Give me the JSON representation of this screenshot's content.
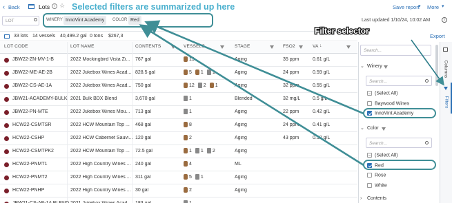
{
  "header": {
    "back_label": "Back",
    "title": "Lots",
    "save_report_label": "Save report",
    "more_label": "More"
  },
  "filter_bar": {
    "lot_placeholder": "LOT",
    "winery_key": "WINERY",
    "winery_value": "InnoVint Academy",
    "color_key": "COLOR",
    "color_value": "Red",
    "last_updated": "Last updated 1/10/24, 10:02 AM"
  },
  "summary": {
    "lots": "33 lots",
    "vessels": "14 vessels",
    "gallons": "40,499.2 gal",
    "tons": "0 tons",
    "value": "$267,3",
    "export_label": "Export"
  },
  "columns": [
    "LOT CODE",
    "LOT NAME",
    "CONTENTS",
    "VESSELS",
    "STAGE",
    "FSO2",
    "VA"
  ],
  "rows": [
    {
      "code": "JBW22-ZN-MV-1-B",
      "name": "2022 Mockingbird Vista Zi...",
      "contents": "767 gal",
      "vessels": [
        [
          "barrel",
          "13"
        ]
      ],
      "stage": "Aging",
      "fso2": "35 ppm",
      "va": "0.61 g/L"
    },
    {
      "code": "JBW22-ME-AE-2B",
      "name": "2022 Jukebox Wines Acad...",
      "contents": "828.5 gal",
      "vessels": [
        [
          "barrel",
          "5"
        ],
        [
          "barrel",
          "1"
        ],
        [
          "tank",
          "1"
        ]
      ],
      "stage": "Aging",
      "fso2": "24 ppm",
      "va": "0.59 g/L"
    },
    {
      "code": "JBW22-CS-AE-1A",
      "name": "2022 Jukebox Wines Acad...",
      "contents": "750 gal",
      "vessels": [
        [
          "barrel",
          "12"
        ],
        [
          "tank",
          "2"
        ],
        [
          "barrel",
          "1"
        ]
      ],
      "stage": "Aging",
      "fso2": "32 ppm",
      "va": "0.55 g/L"
    },
    {
      "code": "JBW21-ACADEMY-BULK",
      "name": "2021 Bulk BDX Blend",
      "contents": "3,670 gal",
      "vessels": [
        [
          "tank",
          "1"
        ]
      ],
      "stage": "Blended",
      "fso2": "32 mg/L",
      "va": "0.5 g/L"
    },
    {
      "code": "JBW22-PN-MTE",
      "name": "2022 Jukebox Wines Mou...",
      "contents": "713 gal",
      "vessels": [
        [
          "tank",
          "1"
        ]
      ],
      "stage": "Aging",
      "fso2": "22 ppm",
      "va": "0.42 g/L"
    },
    {
      "code": "HCW22-CSMTSR",
      "name": "2022 HCW Mountain Top ...",
      "contents": "468 gal",
      "vessels": [
        [
          "barrel",
          "8"
        ]
      ],
      "stage": "Aging",
      "fso2": "24 ppm",
      "va": "0.41 g/L"
    },
    {
      "code": "HCW22-CSHP",
      "name": "2022 HCW Cabernet Sauvi...",
      "contents": "120 gal",
      "vessels": [
        [
          "barrel",
          "2"
        ]
      ],
      "stage": "Aging",
      "fso2": "43 ppm",
      "va": "0.32 g/L"
    },
    {
      "code": "HCW22-CSMTPK2",
      "name": "2022 HCW Mountain Top ...",
      "contents": "72.5 gal",
      "vessels": [
        [
          "barrel",
          "1"
        ],
        [
          "tank",
          "1"
        ],
        [
          "tank",
          "2"
        ]
      ],
      "stage": "Aging",
      "fso2": "",
      "va": ""
    },
    {
      "code": "HCW22-PNMT1",
      "name": "2022 High Country Wines ...",
      "contents": "240 gal",
      "vessels": [
        [
          "barrel",
          "4"
        ]
      ],
      "stage": "ML",
      "fso2": "",
      "va": ""
    },
    {
      "code": "HCW22-PNMT2",
      "name": "2022 High Country Wines ...",
      "contents": "311 gal",
      "vessels": [
        [
          "barrel",
          "5"
        ],
        [
          "tank",
          "1"
        ]
      ],
      "stage": "Aging",
      "fso2": "",
      "va": ""
    },
    {
      "code": "HCW22-PNHP",
      "name": "2022 High Country Wines ...",
      "contents": "30 gal",
      "vessels": [
        [
          "barrel",
          "2"
        ]
      ],
      "stage": "Aging",
      "fso2": "",
      "va": ""
    },
    {
      "code": "JBW21-CS-AE-1A BLEND",
      "name": "2021 Jukebox Wines Acad...",
      "contents": "183 gal",
      "vessels": [
        [
          "tank",
          "1"
        ]
      ],
      "stage": "",
      "fso2": "",
      "va": ""
    }
  ],
  "filter_panel": {
    "search_placeholder": "Search...",
    "winery_title": "Winery",
    "winery_options": [
      {
        "label": "(Select All)",
        "state": "ind"
      },
      {
        "label": "Baywood Wines",
        "state": "off"
      },
      {
        "label": "InnoVint Academy",
        "state": "on"
      }
    ],
    "color_title": "Color",
    "color_options": [
      {
        "label": "(Select All)",
        "state": "ind"
      },
      {
        "label": "Red",
        "state": "on"
      },
      {
        "label": "Rose",
        "state": "off"
      },
      {
        "label": "White",
        "state": "off"
      }
    ],
    "contents_title": "Contents",
    "side_tab_columns": "Columns",
    "side_tab_filters": "Filters"
  },
  "annotations": {
    "selected_filters": "Selected filters are summarized up here",
    "filter_selector": "Filter selector"
  },
  "colors": {
    "accent": "#2a6fb5",
    "annotation": "#4ab0ce",
    "arrow": "#3f8e96",
    "wine_red": "#7a1f2a"
  }
}
